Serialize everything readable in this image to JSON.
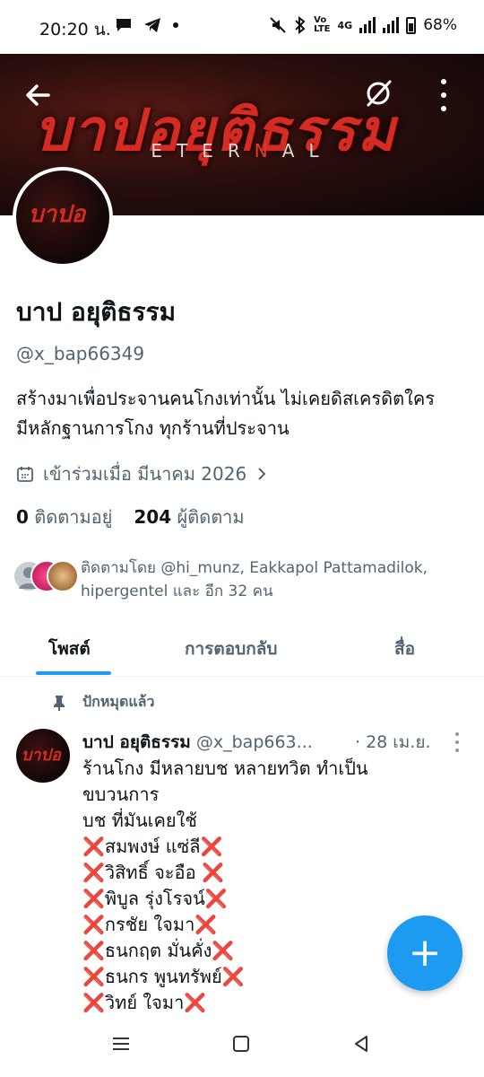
{
  "status_bar": {
    "time": "20:20 น.",
    "battery": "68%",
    "network": "4G"
  },
  "banner": {
    "title": "บาปอยุติธรรม",
    "subtitle_parts": [
      "ETER",
      "N",
      "AL"
    ]
  },
  "avatar": {
    "label": "บาปอ"
  },
  "profile": {
    "name": "บาป อยุติธรรม",
    "handle": "@x_bap66349",
    "bio_line1": "สร้างมาเพื่อประจานคนโกงเท่านั้น ไม่เคยดิสเครดิตใคร",
    "bio_line2": "มีหลักฐานการโกง ทุกร้านที่ประจาน",
    "joined": "เข้าร่วมเมื่อ มีนาคม 2026",
    "following_count": "0",
    "following_label": "ติดตามอยู่",
    "followers_count": "204",
    "followers_label": "ผู้ติดตาม",
    "followed_by": "ติดตามโดย @hi_munz, Eakkapol Pattamadilok, hipergentel และ อีก 32 คน"
  },
  "tabs": [
    {
      "label": "โพสต์"
    },
    {
      "label": "การตอบกลับ"
    },
    {
      "label": "สื่อ"
    }
  ],
  "pinned_label": "ปักหมุดแล้ว",
  "tweet": {
    "avatar_label": "บาปอ",
    "name": "บาป อยุติธรรม",
    "handle": "@x_bap663...",
    "date": "· 28 เม.ย.",
    "lines": [
      "ร้านโกง  มีหลายบช หลายทวิต ทำเป็น",
      "ขบวนการ",
      "บช ที่มันเคยใช้"
    ],
    "names": [
      "สมพงษ์ แซ่ลี",
      "วิสิทธิ์ จะอือ ",
      "พิบูล รุ่งโรจน์",
      "กรชัย ใจมา",
      "ธนกฤต มั่นคั่ง",
      "ธนกร พูนทรัพย์",
      "วิทย์ ใจมา"
    ],
    "cross": "❌"
  },
  "fab": {
    "label": "+"
  },
  "colors": {
    "accent": "#1d9bf0",
    "text": "#0f1419",
    "muted": "#536471",
    "banner_red": "#d62b22"
  },
  "icons": [
    "back-arrow-icon",
    "eye-slash-icon",
    "more-vertical-icon",
    "calendar-icon",
    "chevron-right-icon",
    "pin-icon",
    "plus-icon",
    "menu-icon",
    "home-square-icon",
    "back-triangle-icon"
  ]
}
